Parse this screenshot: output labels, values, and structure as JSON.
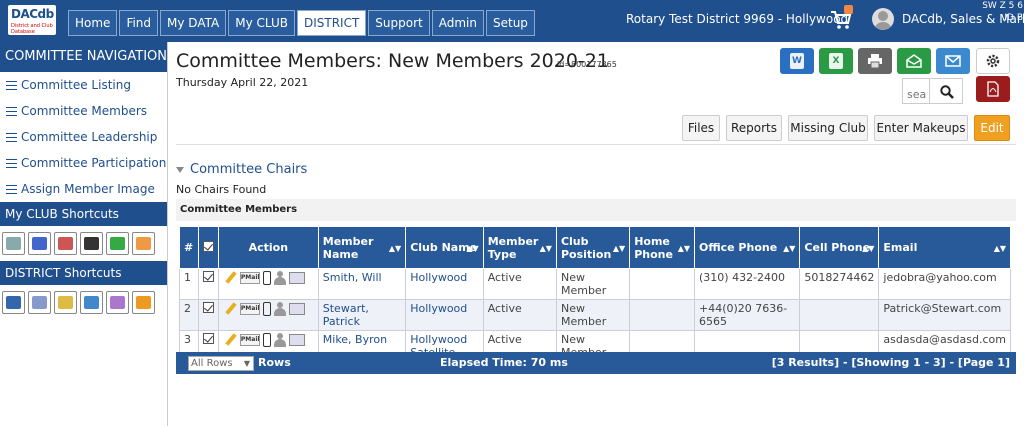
{
  "logo": {
    "line1": "DACdb",
    "line2": "District and Club Database"
  },
  "nav": {
    "tabs": [
      "Home",
      "Find",
      "My DATA",
      "My CLUB",
      "DISTRICT",
      "Support",
      "Admin",
      "Setup"
    ],
    "active": "DISTRICT"
  },
  "header": {
    "district": "Rotary Test District 9969 - Hollywood",
    "user": "DACdb, Sales & Marketing",
    "codes": [
      "SW  Z  5  6",
      "ID   B"
    ]
  },
  "sidebar": {
    "committee_nav_title": "COMMITTEE NAVIGATION",
    "items": [
      "Committee Listing",
      "Committee Members",
      "Committee Leadership",
      "Committee Participation",
      "Assign Member Image"
    ],
    "club_shortcuts_title": "My CLUB Shortcuts",
    "district_shortcuts_title": "DISTRICT Shortcuts"
  },
  "page": {
    "title": "Committee Members: New Members 2020-21",
    "id_label": "id=800177865",
    "date": "Thursday April 22, 2021",
    "search_placeholder": "sea"
  },
  "toolbar": [
    "Files",
    "Reports",
    "Missing Club",
    "Enter Makeups",
    "Edit"
  ],
  "chairs": {
    "title": "Committee Chairs",
    "empty": "No Chairs Found"
  },
  "members_bar": "Committee Members",
  "table": {
    "headers": [
      "#",
      "",
      "Action",
      "Member Name",
      "Club Name",
      "Member Type",
      "Club Position",
      "Home Phone",
      "Office Phone",
      "Cell Phone",
      "Email"
    ],
    "pmail_label": "PMail",
    "rows": [
      {
        "n": "1",
        "name": "Smith, Will",
        "club": "Hollywood",
        "type": "Active",
        "position": "New Member",
        "home": "",
        "office": "(310) 432-2400",
        "cell": "5018274462",
        "email": "jedobra@yahoo.com"
      },
      {
        "n": "2",
        "name": "Stewart, Patrick",
        "club": "Hollywood",
        "type": "Active",
        "position": "New Member",
        "home": "",
        "office": "+44(0)20 7636-6565",
        "cell": "",
        "email": "Patrick@Stewart.com"
      },
      {
        "n": "3",
        "name": "Mike, Byron",
        "club": "Hollywood Satellite",
        "type": "Active",
        "position": "New Member",
        "home": "",
        "office": "",
        "cell": "",
        "email": "asdasda@asdasd.com"
      }
    ]
  },
  "footer": {
    "rows_select": "All Rows",
    "rows_label": "Rows",
    "elapsed": "Elapsed Time: 70 ms",
    "results": "[3 Results] - [Showing 1 - 3] - [Page 1]"
  }
}
